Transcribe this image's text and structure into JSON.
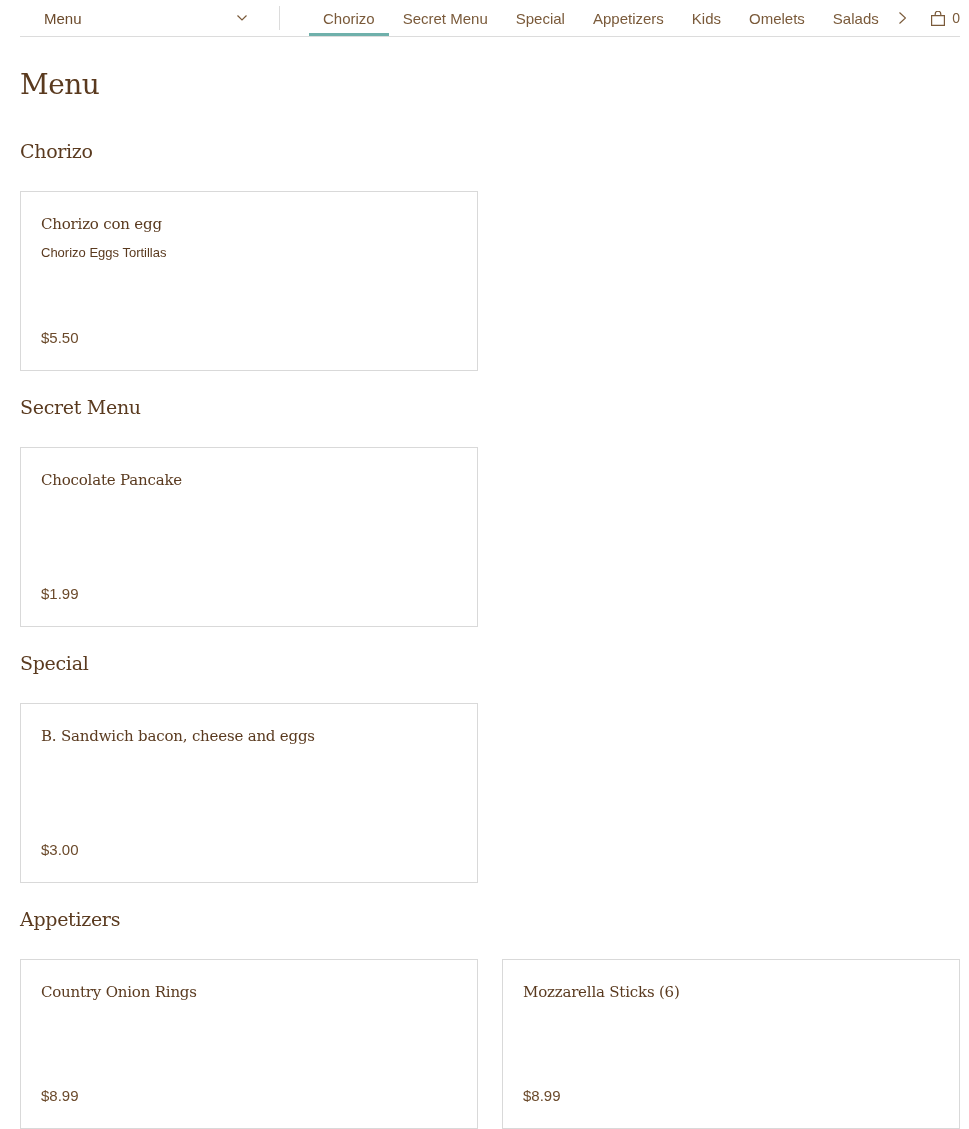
{
  "nav": {
    "dropdown": {
      "label": "Menu"
    },
    "tabs": [
      {
        "label": "Chorizo",
        "selected": true
      },
      {
        "label": "Secret Menu",
        "selected": false
      },
      {
        "label": "Special",
        "selected": false
      },
      {
        "label": "Appetizers",
        "selected": false
      },
      {
        "label": "Kids",
        "selected": false
      },
      {
        "label": "Omelets",
        "selected": false
      },
      {
        "label": "Salads",
        "selected": false
      }
    ],
    "cart": {
      "count": "0"
    }
  },
  "page_title": "Menu",
  "sections": [
    {
      "title": "Chorizo",
      "items": [
        {
          "name": "Chorizo con egg",
          "description": "Chorizo Eggs Tortillas",
          "price": "$5.50"
        }
      ]
    },
    {
      "title": "Secret Menu",
      "items": [
        {
          "name": "Chocolate Pancake",
          "price": "$1.99"
        }
      ]
    },
    {
      "title": "Special",
      "items": [
        {
          "name": "B. Sandwich bacon, cheese and eggs",
          "price": "$3.00"
        }
      ]
    },
    {
      "title": "Appetizers",
      "items": [
        {
          "name": "Country Onion Rings",
          "price": "$8.99"
        },
        {
          "name": "Mozzarella Sticks (6)",
          "price": "$8.99"
        }
      ]
    }
  ]
}
